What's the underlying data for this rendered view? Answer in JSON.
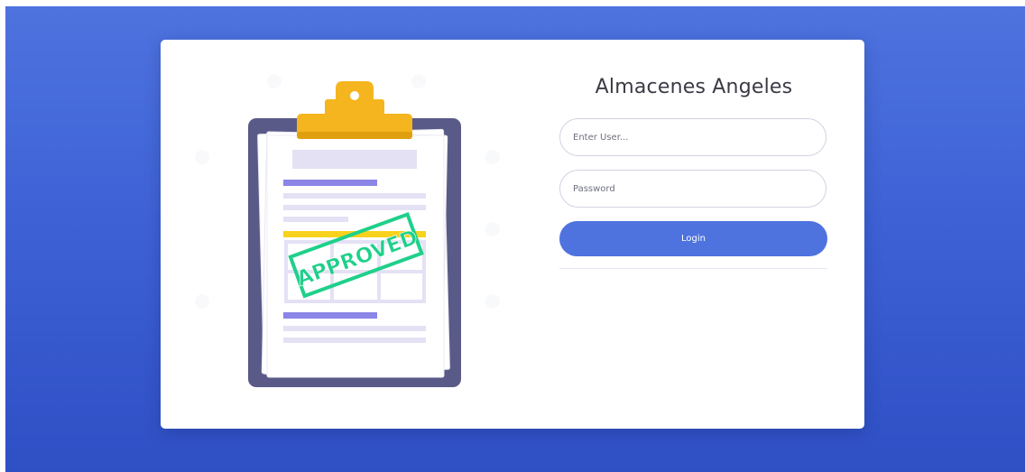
{
  "login": {
    "title": "Almacenes Angeles",
    "user_placeholder": "Enter User...",
    "password_placeholder": "Password",
    "login_label": "Login"
  },
  "illustration": {
    "stamp_text": "APPROVED",
    "icon": "clipboard-approved-icon"
  },
  "colors": {
    "background_top": "#4e73df",
    "background_bottom": "#2f4fc5",
    "primary": "#4e73df",
    "clipboard_board": "#5a5a88",
    "clip": "#f5b51f",
    "stamp": "#1fd08a",
    "text_bar_purple": "#8a85e6",
    "text_bar_light": "#e4e1f5",
    "highlight_yellow": "#f8d21c"
  }
}
